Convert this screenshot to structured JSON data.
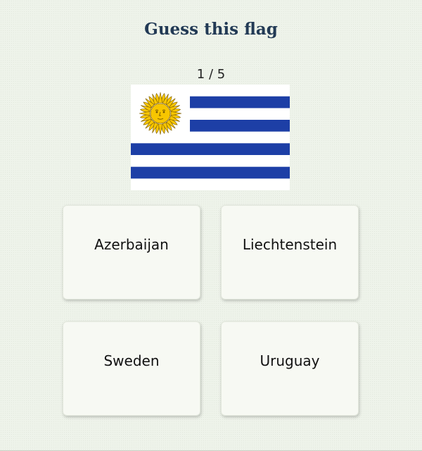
{
  "quiz": {
    "title": "Guess this flag",
    "progress_text": "1 / 5",
    "flag": {
      "icon": "uruguay-flag-icon",
      "colors": {
        "white": "#ffffff",
        "blue": "#1d3fa6",
        "sun": "#f7c600",
        "sun_outline": "#7a5a00"
      }
    },
    "options": [
      {
        "label": "Azerbaijan"
      },
      {
        "label": "Liechtenstein"
      },
      {
        "label": "Sweden"
      },
      {
        "label": "Uruguay"
      }
    ]
  },
  "theme": {
    "background": "#eef3ea",
    "title_color": "#223a55",
    "card_background": "#f7f9f3"
  }
}
